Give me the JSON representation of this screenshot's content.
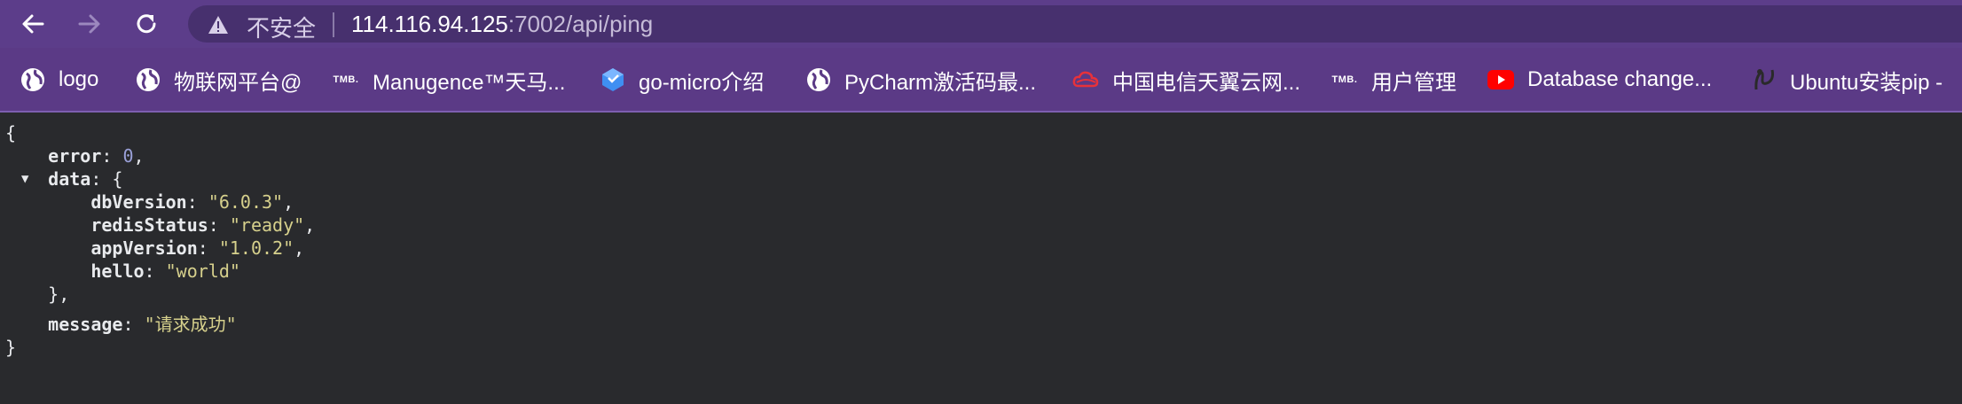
{
  "browser": {
    "insecure_label": "不安全",
    "url_host": "114.116.94.125",
    "url_rest": ":7002/api/ping"
  },
  "bookmarks": [
    {
      "icon": "globe-icon",
      "label": "logo"
    },
    {
      "icon": "globe-icon",
      "label": "物联网平台@"
    },
    {
      "icon": "tmb-icon",
      "icon_text": "TMB.",
      "label": "Manugence™天马..."
    },
    {
      "icon": "cube-icon",
      "label": "go-micro介绍"
    },
    {
      "icon": "globe-icon",
      "label": "PyCharm激活码最..."
    },
    {
      "icon": "cloud-icon",
      "label": "中国电信天翼云网..."
    },
    {
      "icon": "tmb-icon",
      "icon_text": "TMB.",
      "label": "用户管理"
    },
    {
      "icon": "youtube-icon",
      "label": "Database change..."
    },
    {
      "icon": "ubuntu-icon",
      "label": "Ubuntu安装pip -"
    }
  ],
  "json": {
    "open_brace": "{",
    "error_key": "error",
    "error_value": "0",
    "data_key": "data",
    "dbVersion_key": "dbVersion",
    "dbVersion_value": "\"6.0.3\"",
    "redisStatus_key": "redisStatus",
    "redisStatus_value": "\"ready\"",
    "appVersion_key": "appVersion",
    "appVersion_value": "\"1.0.2\"",
    "hello_key": "hello",
    "hello_value": "\"world\"",
    "message_key": "message",
    "message_value": "\"请求成功\"",
    "close_brace": "}"
  }
}
